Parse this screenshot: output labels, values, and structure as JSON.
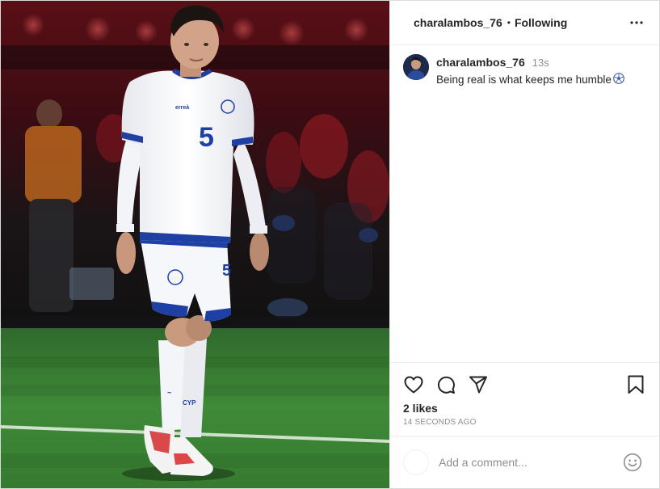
{
  "post": {
    "author": "charalambos_76",
    "separator": "•",
    "follow_status": "Following",
    "more_icon": "more-options-icon"
  },
  "caption": {
    "username": "charalambos_76",
    "time": "13s",
    "text": "Being real is what keeps me humble"
  },
  "photo": {
    "jersey_number": "5"
  },
  "actions": {
    "icons": [
      "heart-icon",
      "comment-icon",
      "share-icon",
      "bookmark-icon"
    ]
  },
  "stats": {
    "likes": "2 likes",
    "posted": "14 SECONDS AGO"
  },
  "comment_box": {
    "placeholder": "Add a comment..."
  },
  "colors": {
    "text": "#262626",
    "secondary": "#8e8e8e",
    "divider": "#efefef",
    "kit_blue": "#1e3fa3"
  }
}
